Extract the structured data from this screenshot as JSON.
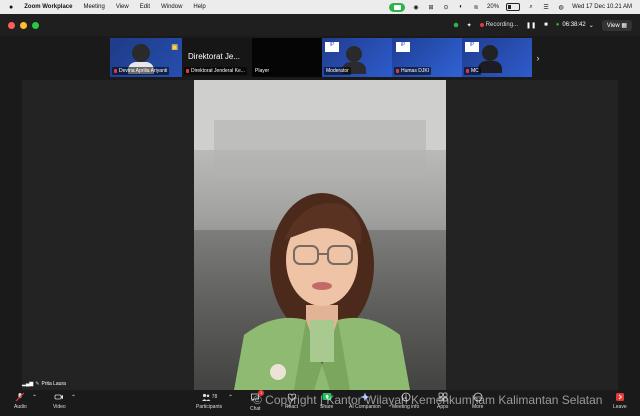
{
  "menubar": {
    "app_name": "Zoom Workplace",
    "menus": [
      "Meeting",
      "View",
      "Edit",
      "Window",
      "Help"
    ],
    "battery": "20%",
    "datetime": "Wed 17 Dec 10.21 AM"
  },
  "window": {
    "recording": "Recording...",
    "timer": "06:38:42",
    "view_label": "View"
  },
  "participants": [
    {
      "name": "Devina Aprilia Ariyanti"
    },
    {
      "name": "Direktorat Je...",
      "display_title": "Direktorat Je..."
    },
    {
      "name": "Direktorat Jenderal Ke..."
    },
    {
      "name": "Player"
    },
    {
      "name": "Moderator"
    },
    {
      "name": "Humas DJKI"
    },
    {
      "name": "MC"
    }
  ],
  "presenter": {
    "name": "Prita Laura"
  },
  "toolbar": {
    "audio": "Audio",
    "video": "Video",
    "participants": "Participants",
    "participants_count": "78",
    "chat": "Chat",
    "chat_badge": "1",
    "react": "React",
    "share": "Share",
    "ai_companion": "AI Companion",
    "meeting_info": "Meeting info",
    "apps": "Apps",
    "more": "More",
    "leave": "Leave"
  },
  "watermark": "© Copyright | Kantor Wilayah Kemenkumham Kalimantan Selatan",
  "colors": {
    "accent_green": "#2cb34a",
    "leave_red": "#e53935",
    "share_green": "#20c05c"
  }
}
